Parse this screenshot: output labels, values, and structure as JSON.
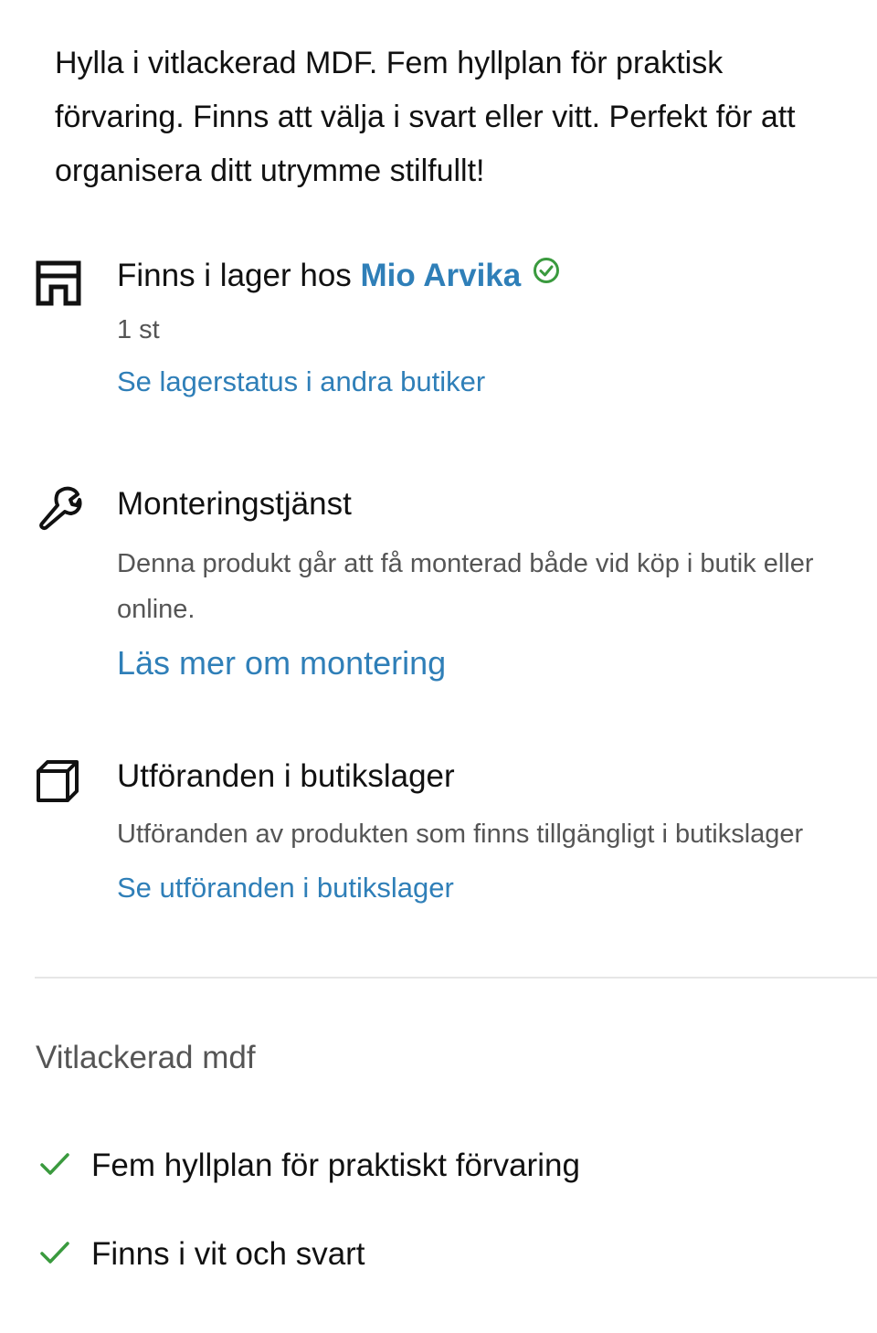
{
  "description": "Hylla i vitlackerad MDF. Fem hyllplan för praktisk förvaring. Finns att välja i svart eller vitt. Perfekt för att organisera ditt utrymme stilfullt!",
  "stock": {
    "title_prefix": "Finns i lager hos",
    "store_name": "Mio Arvika",
    "quantity": "1 st",
    "link": "Se lagerstatus i andra butiker",
    "icon": "store-icon",
    "status_icon": "check-circle-icon",
    "status_color": "#3a9a3e"
  },
  "assembly": {
    "title": "Monteringstjänst",
    "text": "Denna produkt går att få monterad både vid köp i butik eller online.",
    "link": "Läs mer om montering",
    "icon": "wrench-icon"
  },
  "variants": {
    "title": "Utföranden i butikslager",
    "text": "Utföranden av produkten som finns tillgängligt i butikslager",
    "link": "Se utföranden i butikslager",
    "icon": "box-icon"
  },
  "material": "Vitlackerad mdf",
  "features": [
    "Fem hyllplan för praktiskt förvaring",
    "Finns i vit och svart"
  ],
  "colors": {
    "link": "#2f7fb8",
    "check": "#3a9a3e",
    "text": "#111111",
    "muted": "#555555"
  }
}
